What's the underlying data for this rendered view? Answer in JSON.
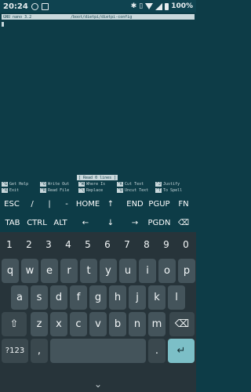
{
  "status_bar": {
    "time": "20:24",
    "battery": "100%"
  },
  "terminal": {
    "title_left": "GNU nano 3.2",
    "title_path": "/boot/dietpi/dietpi-config",
    "status_message": "[ Read 0 lines ]",
    "shortcuts": [
      {
        "key": "^G",
        "label": "Get Help"
      },
      {
        "key": "^O",
        "label": "Write Out"
      },
      {
        "key": "^W",
        "label": "Where Is"
      },
      {
        "key": "^K",
        "label": "Cut Text"
      },
      {
        "key": "^J",
        "label": "Justify"
      },
      {
        "key": "^X",
        "label": "Exit"
      },
      {
        "key": "^R",
        "label": "Read File"
      },
      {
        "key": "^\\",
        "label": "Replace"
      },
      {
        "key": "^U",
        "label": "Uncut Text"
      },
      {
        "key": "^T",
        "label": "To Spell"
      }
    ]
  },
  "extra_keys": {
    "row1": [
      "ESC",
      "/",
      "|",
      "-",
      "HOME",
      "↑",
      "END",
      "PGUP",
      "FN"
    ],
    "row2": [
      "TAB",
      "CTRL",
      "ALT",
      "←",
      "↓",
      "→",
      "PGDN",
      "⌫"
    ]
  },
  "keyboard": {
    "numbers": [
      "1",
      "2",
      "3",
      "4",
      "5",
      "6",
      "7",
      "8",
      "9",
      "0"
    ],
    "row1": [
      "q",
      "w",
      "e",
      "r",
      "t",
      "y",
      "u",
      "i",
      "o",
      "p"
    ],
    "row2": [
      "a",
      "s",
      "d",
      "f",
      "g",
      "h",
      "j",
      "k",
      "l"
    ],
    "row3": [
      "z",
      "x",
      "c",
      "v",
      "b",
      "n",
      "m"
    ],
    "symbols_key": "?123",
    "comma": ",",
    "period": "."
  }
}
